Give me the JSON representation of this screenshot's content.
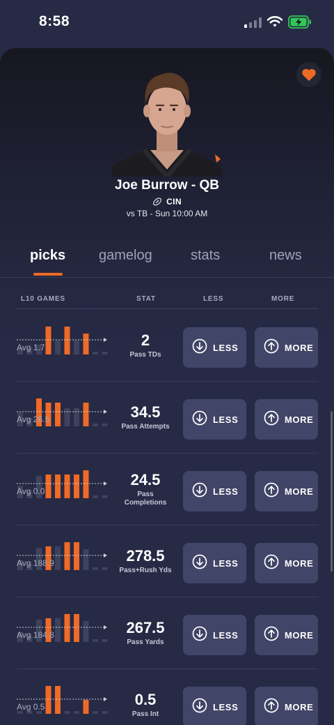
{
  "status_bar": {
    "time": "8:58"
  },
  "player": {
    "name": "Joe Burrow - QB",
    "team": "CIN",
    "matchup": "vs TB - Sun 10:00 AM",
    "favorited": true
  },
  "tabs": [
    {
      "label": "picks",
      "active": true
    },
    {
      "label": "gamelog",
      "active": false
    },
    {
      "label": "stats",
      "active": false
    },
    {
      "label": "news",
      "active": false
    }
  ],
  "table_header": {
    "games": "L10 GAMES",
    "stat": "STAT",
    "less": "LESS",
    "more": "MORE"
  },
  "colors": {
    "accent": "#ef6a26",
    "bar_dim": "#3e425c",
    "button_bg": "#414567",
    "background": "#262a45"
  },
  "picks": [
    {
      "avg": "Avg 1.7",
      "line": "2",
      "stat": "Pass TDs",
      "less": "LESS",
      "more": "MORE",
      "games": [
        0.25,
        0.25,
        0.35,
        1.0,
        0.5,
        1.0,
        0.5,
        0.75,
        0.1,
        0.1
      ],
      "over": [
        false,
        false,
        false,
        true,
        false,
        true,
        false,
        true,
        false,
        false
      ]
    },
    {
      "avg": "Avg 26.5",
      "line": "34.5",
      "stat": "Pass Attempts",
      "less": "LESS",
      "more": "MORE",
      "games": [
        0.5,
        0.3,
        1.0,
        0.85,
        0.85,
        0.65,
        0.65,
        0.85,
        0.1,
        0.1
      ],
      "over": [
        false,
        false,
        true,
        true,
        true,
        false,
        false,
        true,
        false,
        false
      ]
    },
    {
      "avg": "Avg 0.0",
      "line": "24.5",
      "stat": "Pass Completions",
      "less": "LESS",
      "more": "MORE",
      "games": [
        0.45,
        0.25,
        0.8,
        0.85,
        0.85,
        0.85,
        0.85,
        1.0,
        0.1,
        0.1
      ],
      "over": [
        false,
        false,
        false,
        true,
        true,
        true,
        true,
        true,
        false,
        false
      ]
    },
    {
      "avg": "Avg 188.9",
      "line": "278.5",
      "stat": "Pass+Rush Yds",
      "less": "LESS",
      "more": "MORE",
      "games": [
        0.35,
        0.25,
        0.8,
        0.85,
        0.85,
        1.0,
        1.0,
        0.75,
        0.1,
        0.1
      ],
      "over": [
        false,
        false,
        false,
        true,
        false,
        true,
        true,
        false,
        false,
        false
      ]
    },
    {
      "avg": "Avg 184.8",
      "line": "267.5",
      "stat": "Pass Yards",
      "less": "LESS",
      "more": "MORE",
      "games": [
        0.35,
        0.25,
        0.8,
        0.85,
        0.85,
        1.0,
        1.0,
        0.75,
        0.1,
        0.1
      ],
      "over": [
        false,
        false,
        false,
        true,
        false,
        true,
        true,
        false,
        false,
        false
      ]
    },
    {
      "avg": "Avg 0.5",
      "line": "0.5",
      "stat": "Pass Int",
      "less": "LESS",
      "more": "MORE",
      "games": [
        0.1,
        0.1,
        0.1,
        1.0,
        1.0,
        0.1,
        0.1,
        0.5,
        0.1,
        0.1
      ],
      "over": [
        false,
        false,
        false,
        true,
        true,
        false,
        false,
        true,
        false,
        false
      ]
    }
  ]
}
